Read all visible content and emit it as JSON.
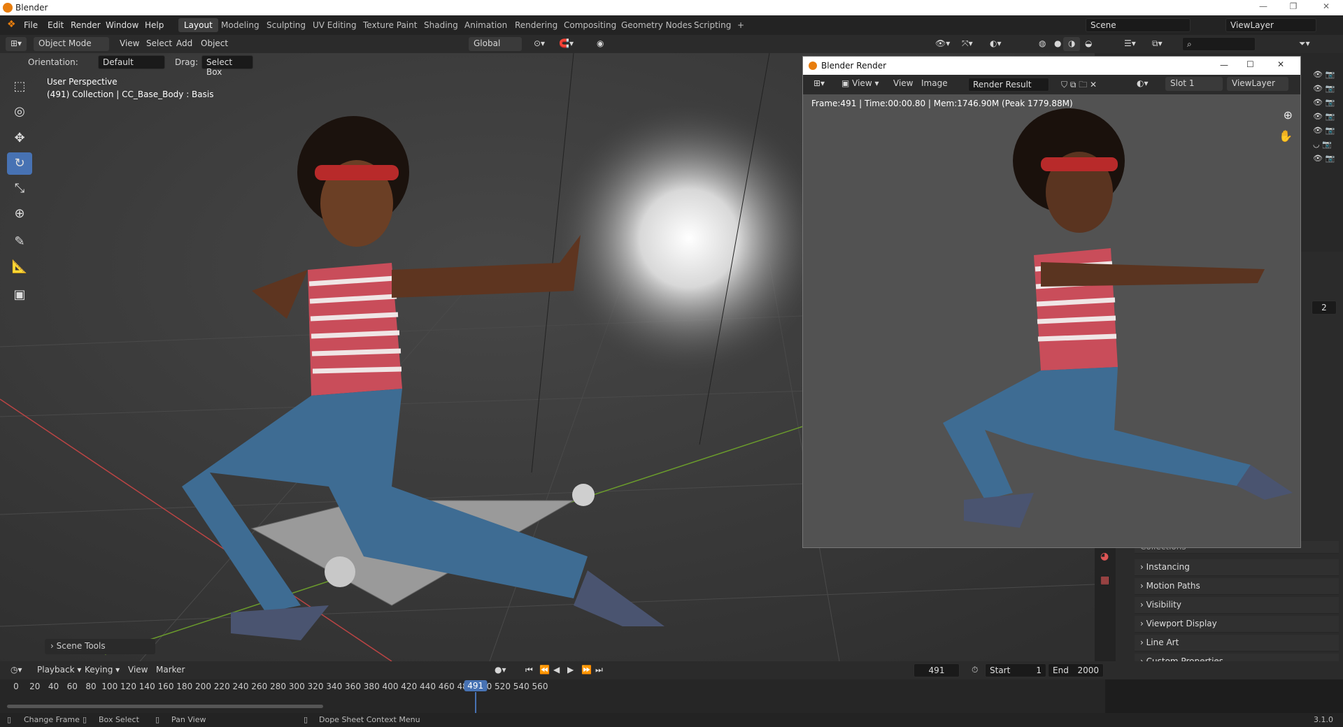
{
  "os_window": {
    "title": "Blender",
    "min": "—",
    "max": "❐",
    "close": "✕"
  },
  "menu": [
    "File",
    "Edit",
    "Render",
    "Window",
    "Help"
  ],
  "workspaces": [
    "Layout",
    "Modeling",
    "Sculpting",
    "UV Editing",
    "Texture Paint",
    "Shading",
    "Animation",
    "Rendering",
    "Compositing",
    "Geometry Nodes",
    "Scripting",
    "+"
  ],
  "active_workspace": "Layout",
  "scene_field": "Scene",
  "viewlayer_field": "ViewLayer",
  "header": {
    "mode": "Object Mode",
    "items": [
      "View",
      "Select",
      "Add",
      "Object"
    ],
    "transform": "Global"
  },
  "tool_settings": {
    "orientation_label": "Orientation:",
    "orientation_value": "Default",
    "drag_label": "Drag:",
    "drag_value": "Select Box"
  },
  "viewport": {
    "overlay_line1": "User Perspective",
    "overlay_line2": "(491) Collection | CC_Base_Body : Basis",
    "scene_tools": "Scene Tools"
  },
  "tools": [
    {
      "name": "select-box-tool",
      "glyph": "⬚"
    },
    {
      "name": "cursor-tool",
      "glyph": "◎"
    },
    {
      "name": "move-tool",
      "glyph": "✥"
    },
    {
      "name": "rotate-tool",
      "glyph": "↻"
    },
    {
      "name": "scale-tool",
      "glyph": "⤡"
    },
    {
      "name": "transform-tool",
      "glyph": "⊕"
    },
    {
      "name": "annotate-tool",
      "glyph": "✎"
    },
    {
      "name": "measure-tool",
      "glyph": "📐"
    },
    {
      "name": "add-cube-tool",
      "glyph": "▣"
    }
  ],
  "render_window": {
    "title": "Blender Render",
    "view_menu": "View",
    "view2": "View",
    "image": "Image",
    "image_name": "Render Result",
    "slot": "Slot 1",
    "viewlayer": "ViewLayer",
    "info": "Frame:491 | Time:00:00.80 | Mem:1746.90M (Peak 1779.88M)"
  },
  "properties": {
    "counter": "2",
    "sections": [
      "Collections",
      "Instancing",
      "Motion Paths",
      "Visibility",
      "Viewport Display",
      "Line Art",
      "Custom Properties"
    ]
  },
  "timeline": {
    "menus": [
      "Playback",
      "Keying",
      "View",
      "Marker"
    ],
    "current_frame": "491",
    "start_label": "Start",
    "start": "1",
    "end_label": "End",
    "end": "2000",
    "ticks": [
      "0",
      "20",
      "40",
      "60",
      "80",
      "100",
      "120",
      "140",
      "160",
      "180",
      "200",
      "220",
      "240",
      "260",
      "280",
      "300",
      "320",
      "340",
      "360",
      "380",
      "400",
      "420",
      "440",
      "460",
      "480",
      "500",
      "520",
      "540",
      "560"
    ],
    "playhead": 491
  },
  "statusbar": {
    "change_frame": "Change Frame",
    "box_select": "Box Select",
    "pan_view": "Pan View",
    "context_menu": "Dope Sheet Context Menu",
    "version": "3.1.0"
  }
}
